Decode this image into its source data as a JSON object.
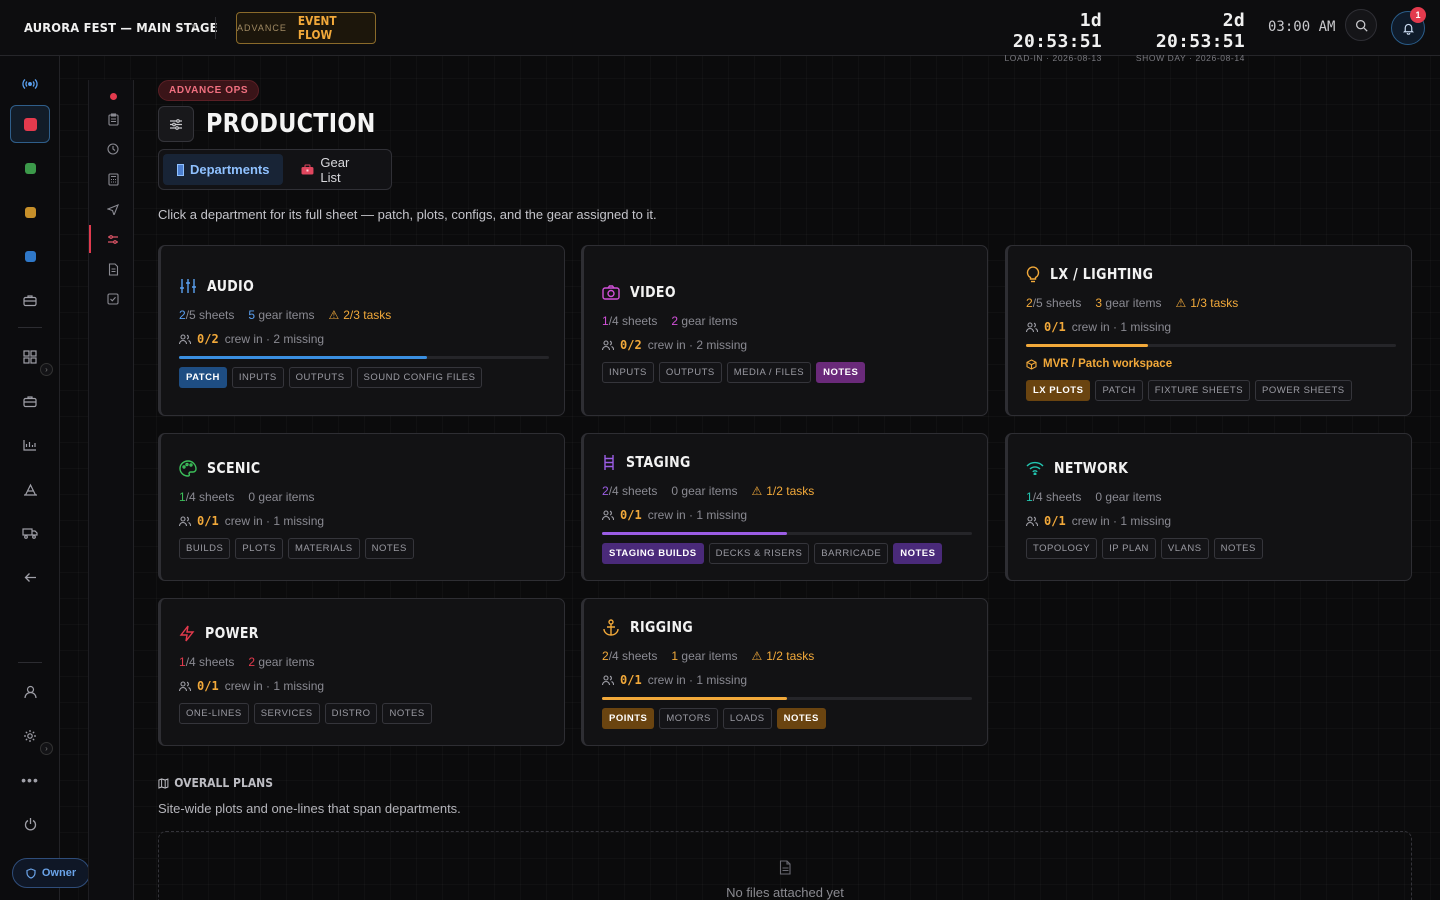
{
  "topbar": {
    "brand": "AURORA FEST — MAIN STAGE",
    "advance_small": "ADVANCE",
    "advance_big": "EVENT FLOW",
    "countdowns": [
      {
        "time": "1d 20:53:51",
        "label": "LOAD-IN · 2026-08-13"
      },
      {
        "time": "2d 20:53:51",
        "label": "SHOW DAY · 2026-08-14"
      }
    ],
    "clock": "03:00 AM",
    "notifications": "1"
  },
  "rail": {
    "owner": "Owner"
  },
  "header": {
    "pill": "ADVANCE OPS",
    "title": "PRODUCTION",
    "tabs": [
      {
        "label": "Departments"
      },
      {
        "label": "Gear List"
      }
    ],
    "intro": "Click a department for its full sheet — patch, plots, configs, and the gear assigned to it."
  },
  "departments": [
    {
      "name": "AUDIO",
      "sheets_done": "2",
      "sheets_total": "/5 sheets",
      "gear_count": "5",
      "gear_label": "gear items",
      "tasks": "2/3 tasks",
      "crew": "0/2",
      "crew_text": "crew in · 2 missing",
      "progress": 0.67,
      "color": "#3a8fe0",
      "tags": [
        "PATCH",
        "INPUTS",
        "OUTPUTS",
        "SOUND CONFIG FILES"
      ]
    },
    {
      "name": "VIDEO",
      "sheets_done": "1",
      "sheets_total": "/4 sheets",
      "gear_count": "2",
      "gear_label": "gear items",
      "crew": "0/2",
      "crew_text": "crew in · 2 missing",
      "color": "#c046c8",
      "tags": [
        "INPUTS",
        "OUTPUTS",
        "MEDIA / FILES",
        "NOTES"
      ]
    },
    {
      "name": "LX / LIGHTING",
      "sheets_done": "2",
      "sheets_total": "/5 sheets",
      "gear_count": "3",
      "gear_label": "gear items",
      "tasks": "1/3 tasks",
      "crew": "0/1",
      "crew_text": "crew in · 1 missing",
      "progress": 0.33,
      "mvr": "MVR / Patch workspace",
      "color": "#f2a93a",
      "tags": [
        "LX PLOTS",
        "PATCH",
        "FIXTURE SHEETS",
        "POWER SHEETS"
      ]
    },
    {
      "name": "SCENIC",
      "sheets_done": "1",
      "sheets_total": "/4 sheets",
      "gear_count": "0",
      "gear_label": "gear items",
      "crew": "0/1",
      "crew_text": "crew in · 1 missing",
      "color": "#3cbf5a",
      "tags": [
        "BUILDS",
        "PLOTS",
        "MATERIALS",
        "NOTES"
      ]
    },
    {
      "name": "STAGING",
      "sheets_done": "2",
      "sheets_total": "/4 sheets",
      "gear_count": "0",
      "gear_label": "gear items",
      "tasks": "1/2 tasks",
      "crew": "0/1",
      "crew_text": "crew in · 1 missing",
      "progress": 0.5,
      "color": "#9b5de5",
      "tags": [
        "STAGING BUILDS",
        "DECKS & RISERS",
        "BARRICADE",
        "NOTES"
      ]
    },
    {
      "name": "NETWORK",
      "sheets_done": "1",
      "sheets_total": "/4 sheets",
      "gear_count": "0",
      "gear_label": "gear items",
      "crew": "0/1",
      "crew_text": "crew in · 1 missing",
      "color": "#22c5b0",
      "tags": [
        "TOPOLOGY",
        "IP PLAN",
        "VLANS",
        "NOTES"
      ]
    },
    {
      "name": "POWER",
      "sheets_done": "1",
      "sheets_total": "/4 sheets",
      "gear_count": "2",
      "gear_label": "gear items",
      "crew": "0/1",
      "crew_text": "crew in · 1 missing",
      "color": "#e33a4d",
      "tags": [
        "ONE-LINES",
        "SERVICES",
        "DISTRO",
        "NOTES"
      ]
    },
    {
      "name": "RIGGING",
      "sheets_done": "2",
      "sheets_total": "/4 sheets",
      "gear_count": "1",
      "gear_label": "gear items",
      "tasks": "1/2 tasks",
      "crew": "0/1",
      "crew_text": "crew in · 1 missing",
      "progress": 0.5,
      "color": "#f2a93a",
      "tags": [
        "POINTS",
        "MOTORS",
        "LOADS",
        "NOTES"
      ]
    }
  ],
  "plans": {
    "title": "OVERALL PLANS",
    "subtitle": "Site-wide plots and one-lines that span departments.",
    "empty": "No files attached yet"
  }
}
